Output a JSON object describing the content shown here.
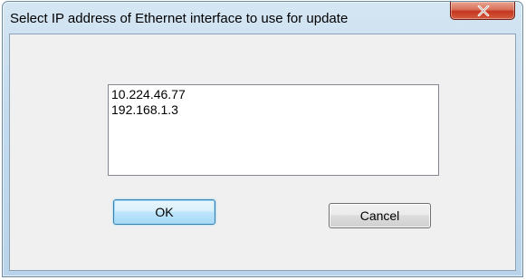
{
  "window": {
    "title": "Select IP address of Ethernet interface to use for update",
    "close_icon": "close-x-icon"
  },
  "list": {
    "items": [
      "10.224.46.77",
      "192.168.1.3"
    ]
  },
  "buttons": {
    "ok_label": "OK",
    "cancel_label": "Cancel"
  },
  "colors": {
    "titlebar": "#c4dbee",
    "client_background": "#f0f0f0",
    "close_button": "#c4371f",
    "ok_button_border": "#3c7fb1"
  }
}
